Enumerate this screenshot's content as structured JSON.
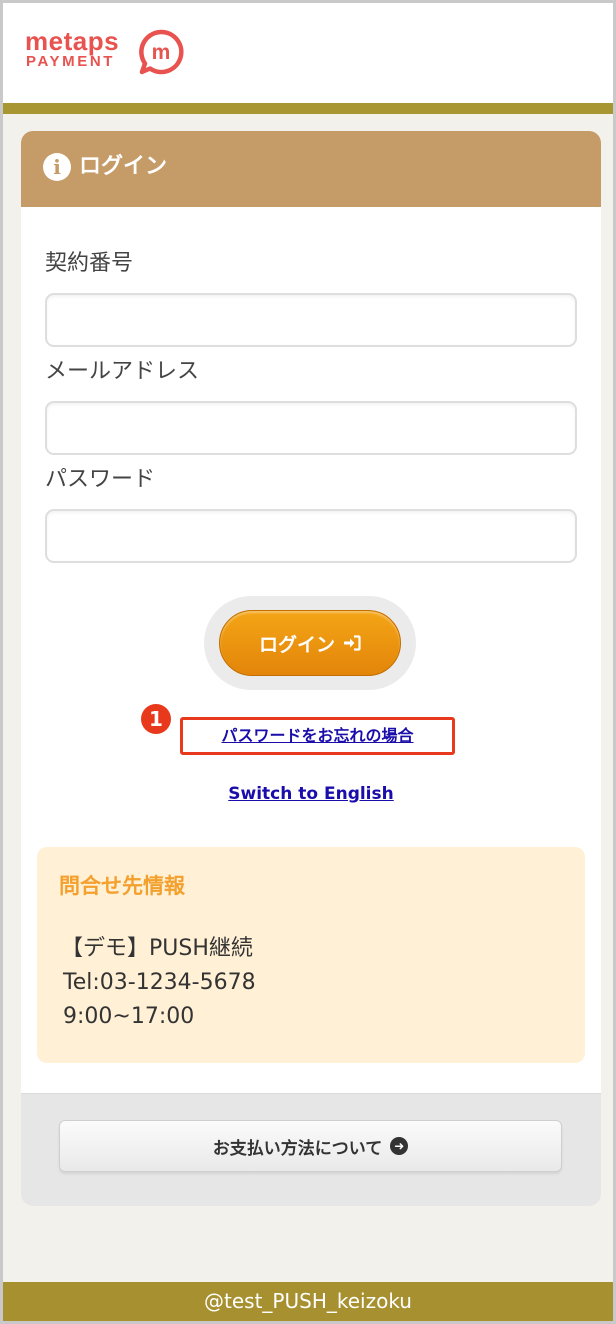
{
  "brand": {
    "name": "metaps",
    "sub": "PAYMENT",
    "mark_letter": "m",
    "color": "#e8534f"
  },
  "login_panel": {
    "title": "ログイン",
    "header_color": "#c59b67",
    "fields": [
      {
        "label": "契約番号",
        "value": ""
      },
      {
        "label": "メールアドレス",
        "value": ""
      },
      {
        "label": "パスワード",
        "value": ""
      }
    ],
    "login_button": "ログイン",
    "login_button_color": "#eb9210",
    "step_marker": "1",
    "forgot_link": "パスワードをお忘れの場合",
    "switch_language": "Switch to English"
  },
  "contact": {
    "title": "問合せ先情報",
    "name": "【デモ】PUSH継続",
    "tel": "Tel:03-1234-5678",
    "hours": "9:00~17:00"
  },
  "payment_button": "お支払い方法について",
  "footer": "@test_PUSH_keizoku",
  "icons": [
    "info-icon",
    "sign-in-icon",
    "arrow-circle-right-icon"
  ]
}
